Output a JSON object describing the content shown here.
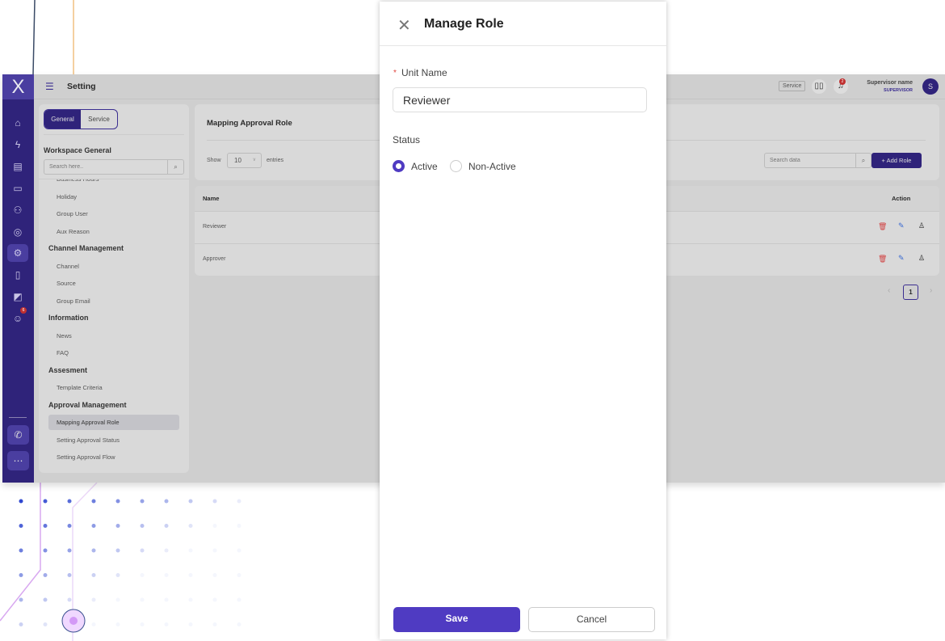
{
  "app": {
    "logo": "X",
    "page_title": "Setting",
    "service_badge": "Service",
    "notif_count": "2",
    "user_name": "Supervisor name",
    "user_role": "SUPERVISOR",
    "avatar_initial": "S"
  },
  "rail": {
    "items": [
      "home-icon",
      "bolt-icon",
      "document-icon",
      "ticket-icon",
      "users-icon",
      "contact-icon",
      "settings-icon",
      "file-icon",
      "monitor-chart-icon",
      "chat-icon"
    ],
    "chat_badge": "6",
    "bottom": [
      "phone-icon",
      "message-icon"
    ]
  },
  "settings_nav": {
    "tabs": [
      "General",
      "Service"
    ],
    "section_title": "Workspace General",
    "search_placeholder": "Search here..",
    "groups": [
      {
        "heading": "",
        "items": [
          "Business Hours",
          "Holiday",
          "Group User",
          "Aux Reason"
        ]
      },
      {
        "heading": "Channel Management",
        "items": [
          "Channel",
          "Source",
          "Group Email"
        ]
      },
      {
        "heading": "Information",
        "items": [
          "News",
          "FAQ"
        ]
      },
      {
        "heading": "Assesment",
        "items": [
          "Template Criteria"
        ]
      },
      {
        "heading": "Approval Management",
        "items": [
          "Mapping Approval Role",
          "Setting Approval Status",
          "Setting Approval Flow"
        ]
      }
    ],
    "active_item": "Mapping Approval Role"
  },
  "content": {
    "title": "Mapping Approval Role",
    "show_label": "Show",
    "entries_value": "10",
    "entries_label": "entries",
    "search_placeholder": "Search data",
    "add_button": "+ Add Role",
    "table": {
      "headers": {
        "name": "Name",
        "action": "Action"
      },
      "rows": [
        {
          "name": "Reviewer"
        },
        {
          "name": "Approver"
        }
      ]
    },
    "pagination": {
      "current": "1"
    }
  },
  "modal": {
    "title": "Manage Role",
    "required_mark": "*",
    "unit_label": "Unit Name",
    "unit_value": "Reviewer",
    "status_label": "Status",
    "status_options": [
      "Active",
      "Non-Active"
    ],
    "status_selected": "Active",
    "save": "Save",
    "cancel": "Cancel"
  },
  "colors": {
    "primary": "#4f3bc2",
    "rail": "#2f237a",
    "danger": "#e0443e"
  }
}
